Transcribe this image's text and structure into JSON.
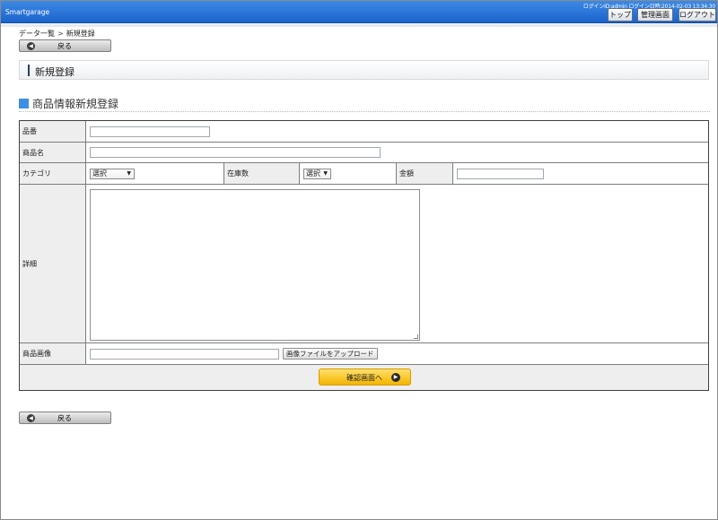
{
  "header": {
    "brand": "Smartgarage",
    "login_info": "ログインID:admin ログイン日時:2014-02-03 13:34:30",
    "nav": {
      "top": "トップ",
      "admin": "管理画面",
      "logout": "ログアウト"
    }
  },
  "breadcrumb": {
    "parent": "データ一覧",
    "separator": ">",
    "current": "新規登録"
  },
  "back_label": "戻る",
  "page_title": "新規登録",
  "section_title": "商品情報新規登録",
  "form": {
    "part_number_label": "品番",
    "product_name_label": "商品名",
    "category_label": "カテゴリ",
    "category_value": "選択",
    "stock_label": "在庫数",
    "stock_value": "選択",
    "price_label": "金額",
    "detail_label": "詳細",
    "image_label": "商品画像",
    "upload_label": "画像ファイルをアップロード",
    "confirm_label": "確認画面へ"
  },
  "icons": {
    "back": "arrow-left-circle-icon",
    "confirm": "arrow-right-circle-icon",
    "select": "dropdown-arrow-icon"
  },
  "colors": {
    "header": "#1b63cc",
    "accent_square": "#3d8ee6",
    "confirm_button": "#f4b400",
    "label_bg": "#eeeeee"
  }
}
